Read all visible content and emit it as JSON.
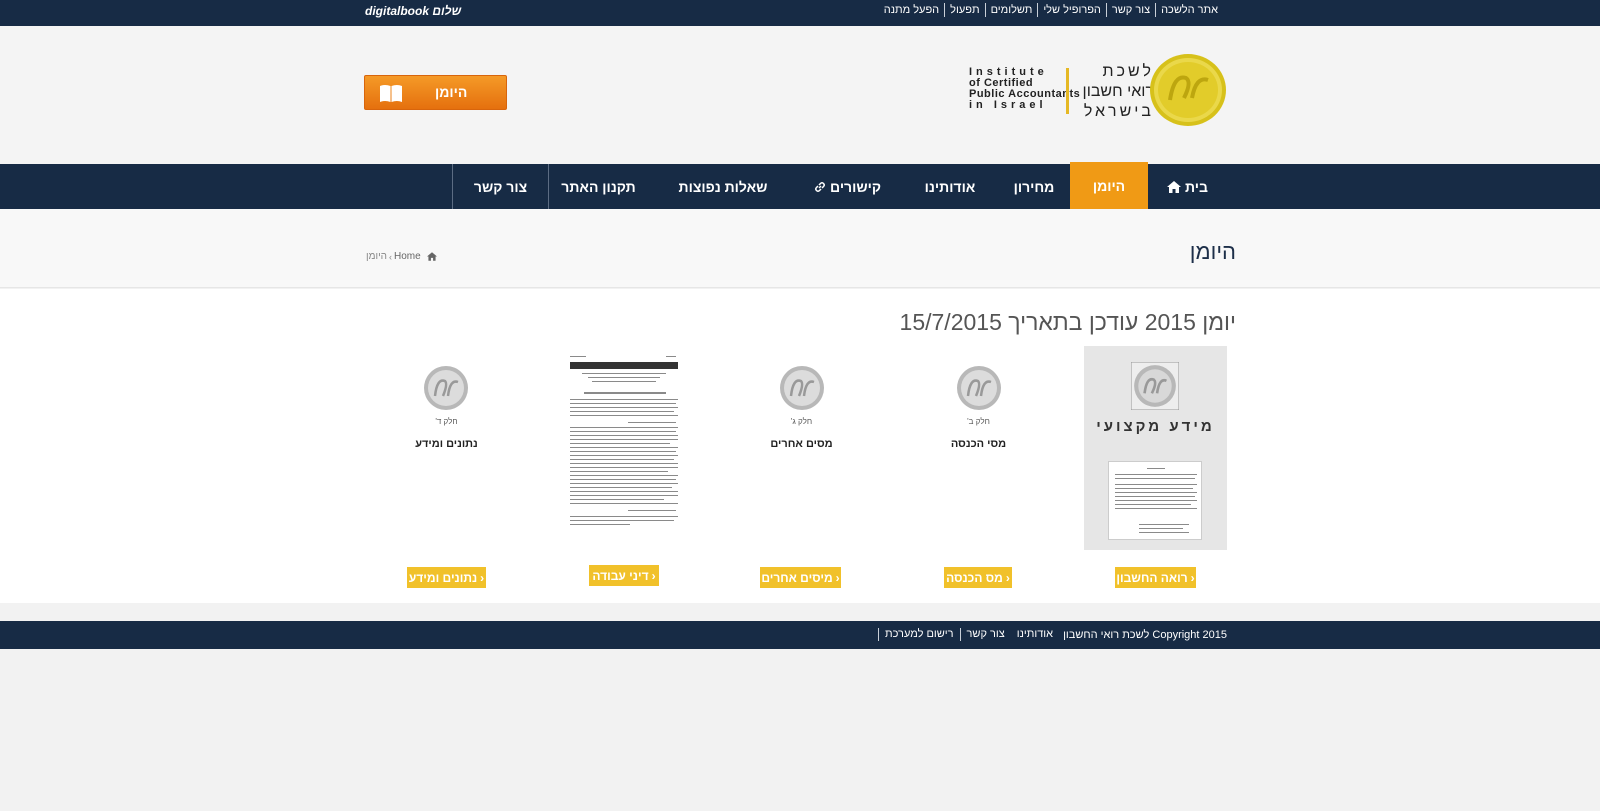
{
  "topbar": {
    "greeting": "שלום digitalbook",
    "links": [
      "אתר הלשכה",
      "צור קשר",
      "הפרופיל שלי",
      "תשלומים",
      "תפעול",
      "הפעל מתנה"
    ]
  },
  "header": {
    "yoman_button": "היומן",
    "logo": {
      "en_lines": [
        "Institute",
        "of Certified",
        "Public Accountants",
        "in Israel"
      ],
      "he_lines": [
        "לשכת",
        "רואי חשבון",
        "בישראל"
      ]
    }
  },
  "nav": {
    "items": [
      "בית",
      "היומן",
      "מחירון",
      "אודותינו",
      "קישורים",
      "שאלות נפוצות",
      "תקנון האתר",
      "צור קשר"
    ],
    "active_index": 1
  },
  "page": {
    "title": "היומן",
    "breadcrumb": [
      "Home",
      "היומן"
    ]
  },
  "main": {
    "title": "יומן 2015 עודכן בתאריך 15/7/2015",
    "cards": [
      {
        "big_title": "מידע מקצועי",
        "button": "רואה החשבון"
      },
      {
        "part": "חלק ב'",
        "name": "מסי הכנסה",
        "button": "מס הכנסה"
      },
      {
        "part": "חלק ג'",
        "name": "מסים אחרים",
        "button": "מיסים אחרים"
      },
      {
        "button": "דיני עבודה"
      },
      {
        "part": "חלק ד'",
        "name": "נתונים ומידע",
        "button": "נתונים ומידע"
      }
    ]
  },
  "footer": {
    "links": [
      "רישום למערכת",
      "צור קשר",
      "אודותינו"
    ],
    "copyright": "Copyright 2015 לשכת רואי החשבון"
  },
  "colors": {
    "navy": "#172b45",
    "orange": "#f09a15",
    "yellow": "#f1c12a"
  }
}
